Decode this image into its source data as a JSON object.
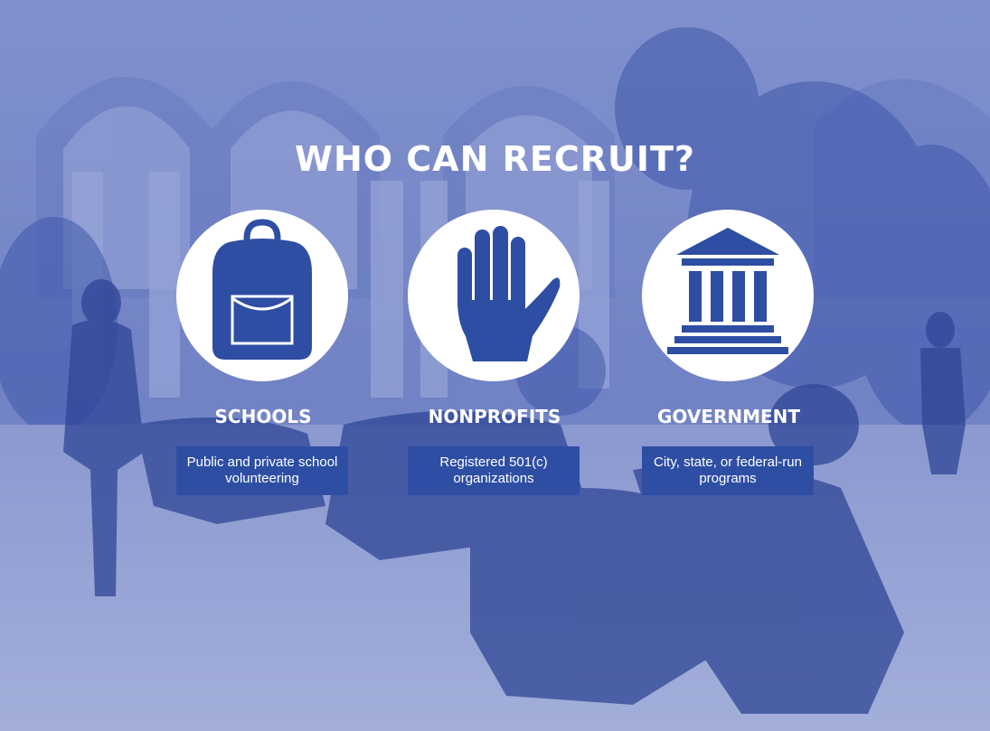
{
  "title": "WHO CAN RECRUIT?",
  "columns": [
    {
      "icon": "backpack-icon",
      "label": "SCHOOLS",
      "description": "Public and private school volunteering"
    },
    {
      "icon": "raised-hand-icon",
      "label": "NONPROFITS",
      "description": "Registered 501(c) organizations"
    },
    {
      "icon": "government-building-icon",
      "label": "GOVERNMENT",
      "description": "City, state, or federal-run programs"
    }
  ],
  "colors": {
    "icon_blue": "#2e4ea3",
    "overlay_blue": "#4a62b5",
    "white": "#ffffff"
  }
}
